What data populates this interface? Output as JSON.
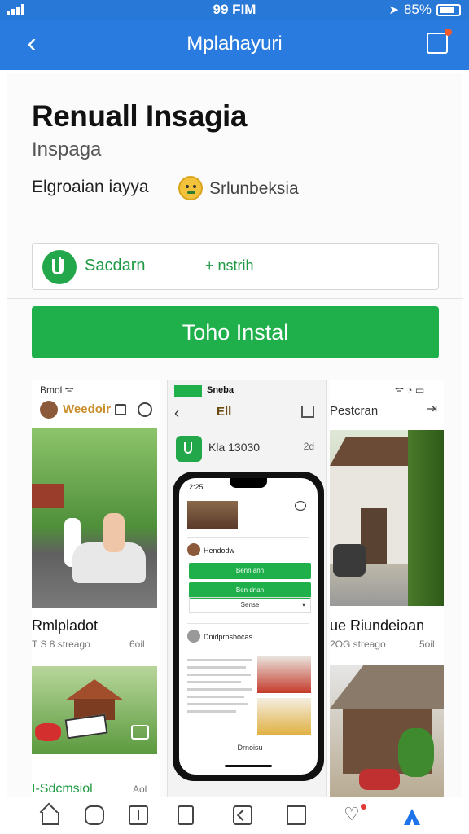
{
  "status_bar": {
    "time": "99 FIM",
    "battery": "85%",
    "icons": [
      "signal-icon",
      "location-icon",
      "battery-icon"
    ]
  },
  "header": {
    "title": "Mplahayuri",
    "icons": [
      "back-icon",
      "edit-icon"
    ]
  },
  "app": {
    "name": "Renuall Insagia",
    "subtitle": "Inspaga",
    "developer": "Elgroaian iayya",
    "emoji_label": "Srlunbeksia"
  },
  "option_row": {
    "label": "Sacdarn",
    "extra": "+ nstrih"
  },
  "install_button": {
    "label": "Toho Instal"
  },
  "screenshots": {
    "left": {
      "status": "Bmol ᯤ",
      "title": "Weedoir",
      "caption_title": "Rmlpladot",
      "caption_sub": "T S 8 streago",
      "caption_right": "6oil",
      "bottom_title": "I-Sdcmsiol",
      "bottom_right": "Aol"
    },
    "center": {
      "status": "Sneba",
      "nav_title": "Ell",
      "app_label": "Kla 13030",
      "app_rating": "2d",
      "screen": {
        "time": "2:25",
        "row1_label": "Hendodw",
        "button1": "Benn ann",
        "button2": "Ben dnan",
        "select": "Sense",
        "row2_label": "Dnidprosbocas",
        "bottom": "Drnoisu"
      }
    },
    "right": {
      "title": "Pestcran",
      "caption_title": "ue Riundeioan",
      "caption_sub": "2OG streago",
      "caption_right": "5oil"
    }
  },
  "bottom_nav": {
    "items": [
      "home-icon",
      "face-icon",
      "doc-icon",
      "phone-icon",
      "upload-icon",
      "map-icon",
      "heart-icon",
      "profile-icon"
    ],
    "heart_glyph": "♡"
  },
  "colors": {
    "header_blue": "#2a7be0",
    "install_green": "#1fb04b",
    "accent_green": "#22a84a"
  }
}
